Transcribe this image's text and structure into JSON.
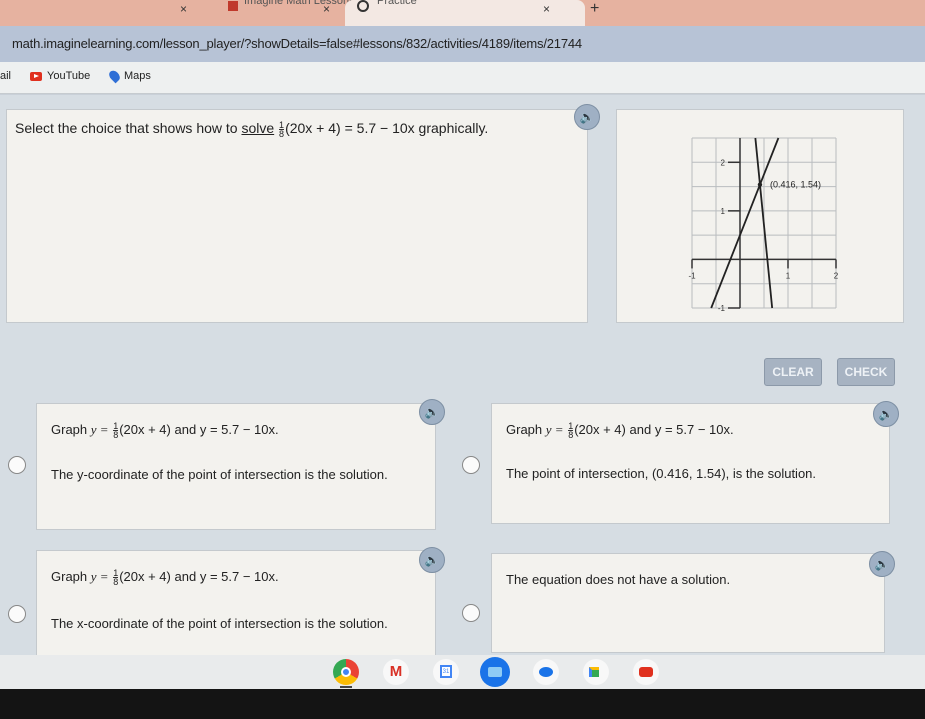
{
  "browser": {
    "tabs": [
      {
        "label": "Imagine Math Lessons",
        "active": false
      },
      {
        "label": "Practice",
        "active": true
      }
    ],
    "close_glyph": "×",
    "new_tab_glyph": "+",
    "url": "math.imaginelearning.com/lesson_player/?showDetails=false#lessons/832/activities/4189/items/21744",
    "bookmarks": [
      {
        "label": "ail",
        "icon": "gmail-icon"
      },
      {
        "label": "YouTube",
        "icon": "youtube-icon"
      },
      {
        "label": "Maps",
        "icon": "maps-icon"
      }
    ]
  },
  "question": {
    "prefix": "Select the choice that shows how to",
    "link": "solve",
    "frac_num": "1",
    "frac_den": "8",
    "equation": "(20x + 4) = 5.7 − 10x",
    "suffix": "graphically."
  },
  "graph": {
    "point_label": "(0.416, 1.54)",
    "x_ticks": [
      "-1",
      "1",
      "2"
    ],
    "y_ticks": [
      "2",
      "1",
      "-1"
    ]
  },
  "chart_data": {
    "type": "line",
    "title": "",
    "xlabel": "",
    "ylabel": "",
    "xlim": [
      -1,
      2
    ],
    "ylim": [
      -1,
      2.5
    ],
    "grid": true,
    "grid_step": 0.5,
    "x_tick_labels": [
      -1,
      1,
      2
    ],
    "y_tick_labels": [
      -1,
      1,
      2
    ],
    "series": [
      {
        "name": "y = (1/8)(20x + 4)",
        "slope": 2.5,
        "intercept": 0.5
      },
      {
        "name": "y = 5.7 − 10x",
        "slope": -10,
        "intercept": 5.7
      }
    ],
    "annotations": [
      {
        "x": 0.416,
        "y": 1.54,
        "text": "(0.416, 1.54)"
      }
    ]
  },
  "buttons": {
    "clear": "CLEAR",
    "check": "CHECK"
  },
  "choices": [
    {
      "line1_prefix": "Graph",
      "eq1_lhs": "y =",
      "frac_num": "1",
      "frac_den": "8",
      "eq1_rhs": "(20x + 4)",
      "and": "and",
      "eq2": "y = 5.7 − 10x.",
      "line2": "The y-coordinate of the point of intersection is the solution."
    },
    {
      "line1_prefix": "Graph",
      "eq1_lhs": "y =",
      "frac_num": "1",
      "frac_den": "8",
      "eq1_rhs": "(20x + 4)",
      "and": "and",
      "eq2": "y = 5.7 − 10x.",
      "line2": "The point of intersection, (0.416, 1.54), is the solution."
    },
    {
      "line1_prefix": "Graph",
      "eq1_lhs": "y =",
      "frac_num": "1",
      "frac_den": "8",
      "eq1_rhs": "(20x + 4)",
      "and": "and",
      "eq2": "y = 5.7 − 10x.",
      "line2": "The x-coordinate of the point of intersection is the solution."
    },
    {
      "line1": "The equation does not have a solution."
    }
  ],
  "shelf": {
    "apps": [
      "chrome",
      "gmail",
      "calendar",
      "files",
      "messages",
      "meet",
      "youtube"
    ],
    "calendar_day": "31"
  },
  "speaker_glyph": "🔈"
}
